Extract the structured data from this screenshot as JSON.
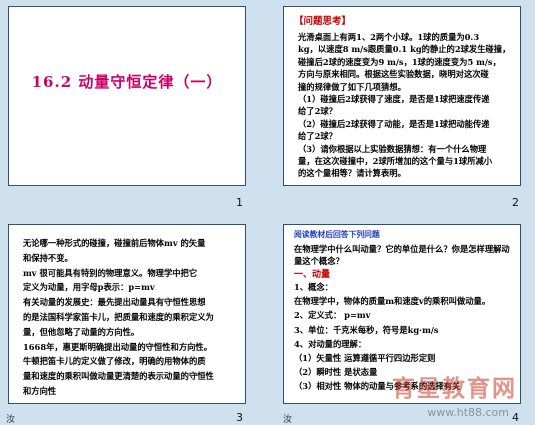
{
  "slides": {
    "s1": {
      "title": "16.2  动量守恒定律（一）",
      "number": "1"
    },
    "s2": {
      "heading": "【问题思考】",
      "lines": [
        "光滑桌面上有两1、2两个小球。1球的质量为0.3",
        "kg，以速度8 m/s跟质量0.1 kg的静止的2球发生碰撞，",
        "碰撞后2球的速度变为9 m/s，1球的速度变为5 m/s，",
        "方向与原来相同。根据这些实验数据，晓明对这次碰",
        "撞的规律做了如下几项猜想。",
        "（1）碰撞后2球获得了速度，是否是1球把速度传递",
        "给了2球？",
        "（2）碰撞后2球获得了动能，是否是1球把动能传递",
        "给了2球？",
        "（3）请你根据以上实验数据猜想：有一个什么物理",
        "量，在这次碰撞中，2球所增加的这个量与1球所减小",
        "的这个量相等？请计算表明。"
      ],
      "number": "2"
    },
    "s3": {
      "lines": [
        "无论哪一种形式的碰撞，碰撞前后物体mv 的矢量",
        "和保持不变。",
        "mv 很可能具有特别的物理意义。物理学中把它",
        "定义为动量，用字母p表示：p=mv",
        "有关动量的发展史：最先提出动量具有守恒性思想",
        "的是法国科学家笛卡儿，把质量和速度的乘积定义为",
        "量，但他忽略了动量的方向性。",
        "1668年，惠更斯明确提出动量的守恒性和方向性。",
        "牛顿把笛卡儿的定义做了修改，明确的用物体的质",
        "量和速度的乘积叫做动量更清楚的表示动量的守恒性",
        "和方向性"
      ],
      "footer_left": "汝",
      "number": "3"
    },
    "s4": {
      "bar": "阅读教材后回答下列问题",
      "q": "在物理学中什么叫动量？它的单位是什么？你是怎样理解动量这个概念？",
      "section": "一、动量",
      "items": [
        "1、概念：",
        "在物理学中，物体的质量m和速度v的乘积叫做动量。",
        "2、定义式：      p=mv",
        "3、单位：千克米每秒，符号是kg·m/s",
        "4、对动量的理解：",
        "（1）矢量性    运算遵循平行四边形定则",
        "（2）瞬时性     是状态量",
        "（3）相对性    物体的动量与参考系的选择有关"
      ],
      "footer_left": "汝",
      "number": "4"
    }
  },
  "watermark": {
    "main": "育星教育网",
    "url": "www.ht88.com"
  }
}
